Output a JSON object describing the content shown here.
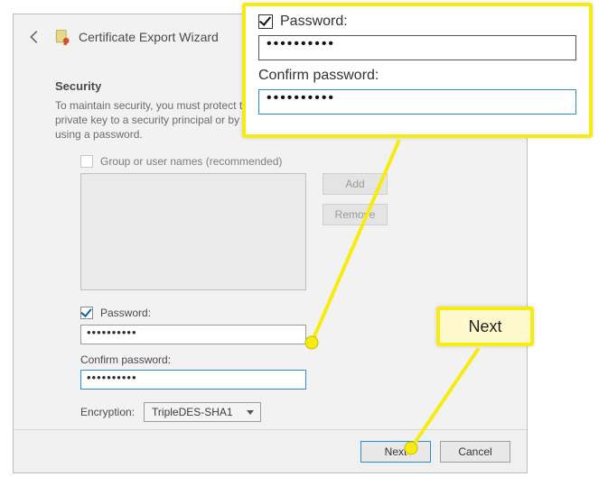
{
  "wizard": {
    "title": "Certificate Export Wizard",
    "security_heading": "Security",
    "security_desc": "To maintain security, you must protect the private key to a security principal or by using a password.",
    "group_checkbox_label": "Group or user names (recommended)",
    "add_btn": "Add",
    "remove_btn": "Remove",
    "password_checkbox_label": "Password:",
    "password_value": "••••••••••",
    "confirm_label": "Confirm password:",
    "confirm_value": "••••••••••",
    "encryption_label": "Encryption:",
    "encryption_selected": "TripleDES-SHA1",
    "next_btn": "Next",
    "cancel_btn": "Cancel"
  },
  "callout": {
    "password_label": "Password:",
    "password_value": "••••••••••",
    "confirm_label": "Confirm password:",
    "confirm_value": "••••••••••",
    "next_label": "Next"
  },
  "colors": {
    "highlight": "#f7ec10",
    "focus": "#2a8dd4"
  }
}
